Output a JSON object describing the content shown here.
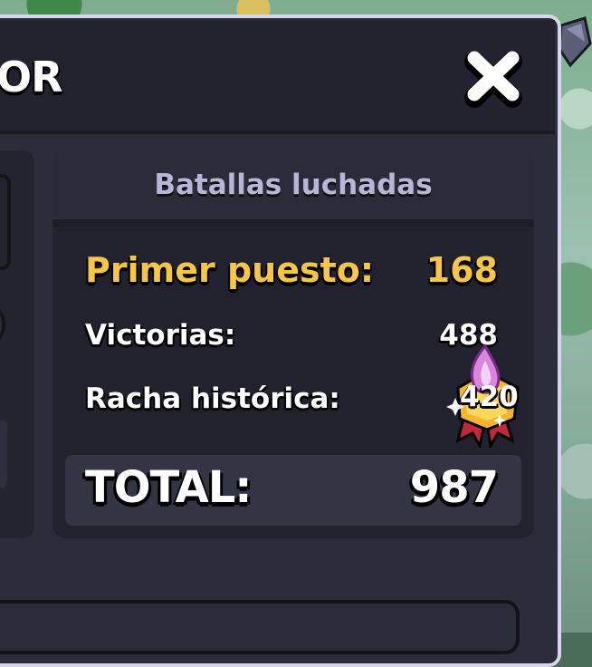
{
  "header": {
    "title_fragment": "OR"
  },
  "stats": {
    "heading": "Batallas luchadas",
    "first_place": {
      "label": "Primer puesto:",
      "value": "168"
    },
    "victories": {
      "label": "Victorias:",
      "value": "488"
    },
    "best_streak": {
      "label": "Racha histórica:",
      "value": "420"
    },
    "total": {
      "label": "TOTAL:",
      "value": "987"
    }
  },
  "icons": {
    "close": "close-icon",
    "medal": "streak-medal-icon"
  },
  "colors": {
    "highlight": "#f7c644",
    "panel_bg": "#2c2d3b",
    "heading": "#b8b6d8"
  }
}
